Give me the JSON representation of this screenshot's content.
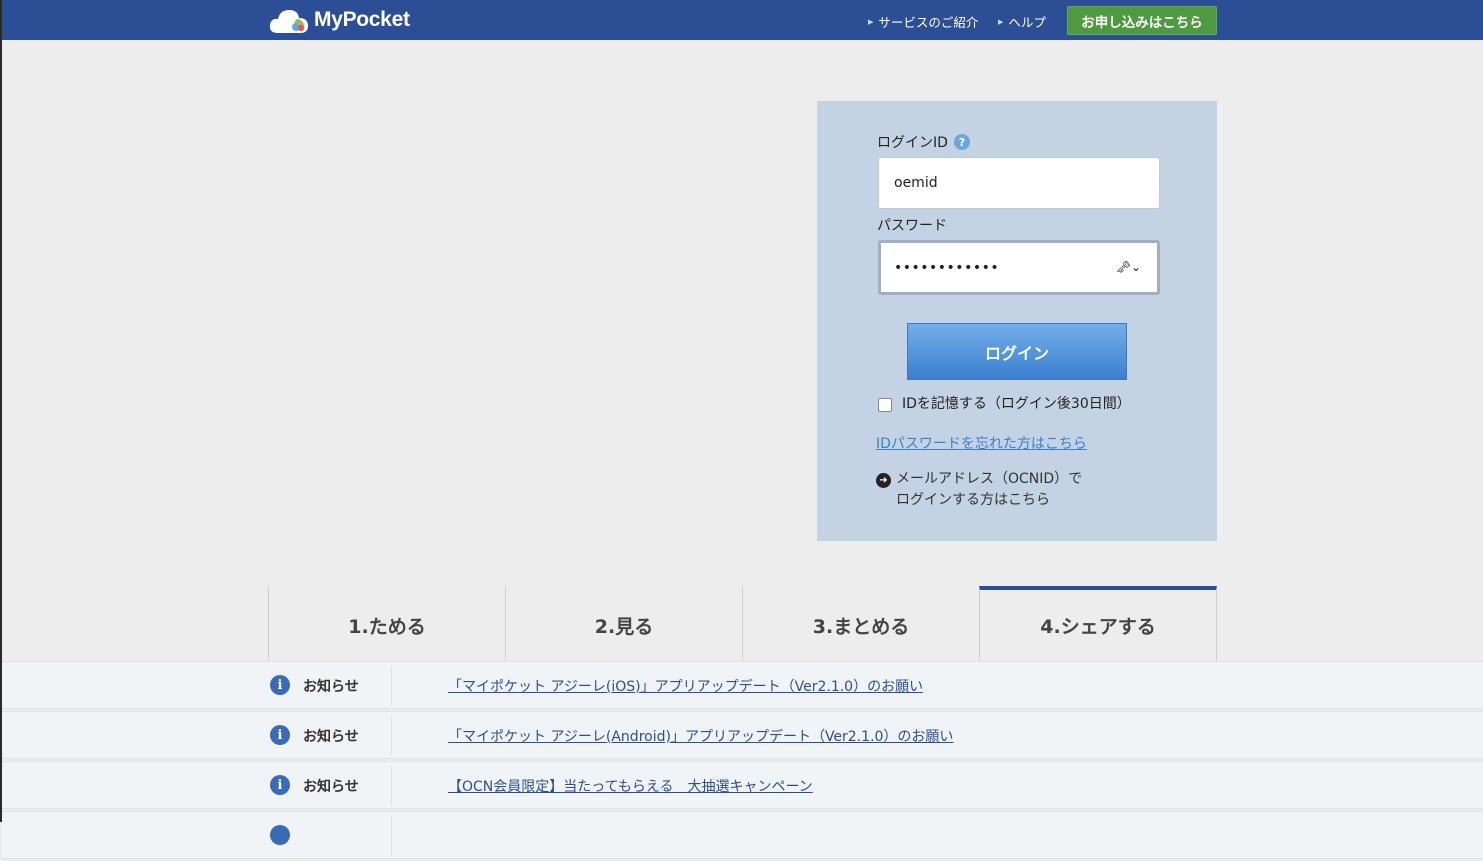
{
  "header": {
    "logo_text": "MyPocket",
    "nav": [
      {
        "label": "サービスのご紹介"
      },
      {
        "label": "ヘルプ"
      }
    ],
    "signup_label": "お申し込みはこちら"
  },
  "login": {
    "id_label": "ログインID",
    "help_glyph": "?",
    "id_value": "oemid",
    "password_label": "パスワード",
    "password_value": "••••••••••••",
    "login_button": "ログイン",
    "remember_label": "IDを記憶する（ログイン後30日間）",
    "forgot_link": "IDパスワードを忘れた方はこちら",
    "ocn_line1": "メールアドレス（OCNID）で",
    "ocn_line2": "ログインする方はこちら"
  },
  "tabs": [
    {
      "label": "1.ためる",
      "active": false
    },
    {
      "label": "2.見る",
      "active": false
    },
    {
      "label": "3.まとめる",
      "active": false
    },
    {
      "label": "4.シェアする",
      "active": true
    }
  ],
  "news": [
    {
      "category": "お知らせ",
      "title": "「マイポケット アジーレ(iOS)」アプリアップデート（Ver2.1.0）のお願い"
    },
    {
      "category": "お知らせ",
      "title": "「マイポケット アジーレ(Android)」アプリアップデート（Ver2.1.0）のお願い"
    },
    {
      "category": "お知らせ",
      "title": "【OCN会員限定】当たってもらえる　大抽選キャンペーン"
    }
  ],
  "colors": {
    "header_bg": "#2c4e94",
    "signup_bg": "#4f9a40",
    "panel_bg": "#c3d3e3",
    "login_button": "#3b7fcf"
  }
}
